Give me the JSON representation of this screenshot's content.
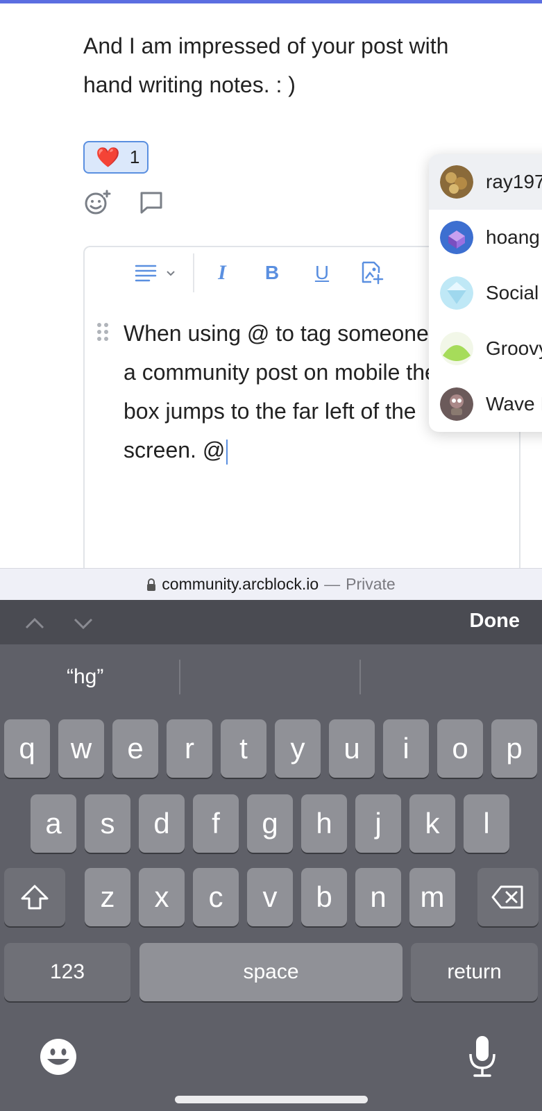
{
  "colors": {
    "accent": "#5a8fe0",
    "top_accent": "#5b6ee1",
    "keyboard_bg": "#5f6068",
    "key_bg": "#909197"
  },
  "post": {
    "text_line1": "And I am impressed of your post with",
    "text_line2": "hand writing notes. : )"
  },
  "reaction": {
    "emoji": "❤️",
    "count": "1"
  },
  "actions": {
    "add_reaction_icon": "smiley-add-icon",
    "comment_icon": "comment-bubble-icon"
  },
  "editor": {
    "toolbar": {
      "paragraph_icon": "align-lines-icon",
      "dropdown_icon": "chevron-down-icon",
      "italic": "I",
      "bold": "B",
      "underline": "U",
      "insert_image_icon": "image-add-icon"
    },
    "text": "When using @ to tag someone in\na community post on mobile the\nbox jumps to the far left of the\nscreen. @"
  },
  "mentions": [
    {
      "name": "ray197",
      "avatar_icon": "coins-avatar",
      "active": true
    },
    {
      "name": "hoang",
      "avatar_icon": "cube-avatar"
    },
    {
      "name": "Social",
      "avatar_icon": "crystal-avatar"
    },
    {
      "name": "Groovy",
      "avatar_icon": "green-shape-avatar"
    },
    {
      "name": "Wave I",
      "avatar_icon": "robot-avatar"
    }
  ],
  "urlbar": {
    "domain": "community.arcblock.io",
    "separator": "—",
    "mode": "Private"
  },
  "keyboard": {
    "done": "Done",
    "suggestion": "“hg”",
    "row1": [
      "q",
      "w",
      "e",
      "r",
      "t",
      "y",
      "u",
      "i",
      "o",
      "p"
    ],
    "row2": [
      "a",
      "s",
      "d",
      "f",
      "g",
      "h",
      "j",
      "k",
      "l"
    ],
    "row3": [
      "z",
      "x",
      "c",
      "v",
      "b",
      "n",
      "m"
    ],
    "numbers": "123",
    "space": "space",
    "return": "return"
  }
}
